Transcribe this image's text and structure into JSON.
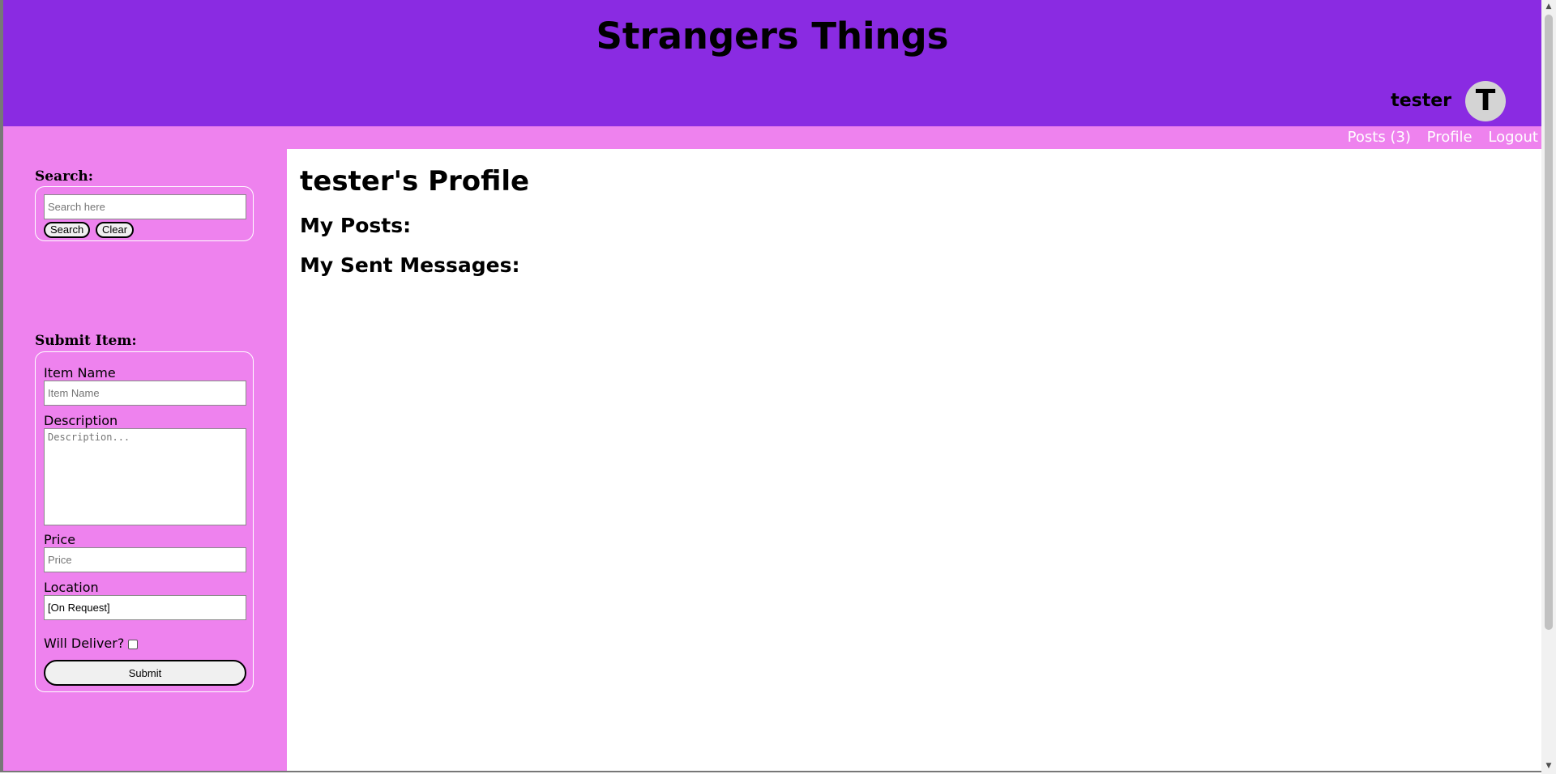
{
  "header": {
    "title": "Strangers Things",
    "username": "tester",
    "avatar_initial": "T",
    "background_color": "#8a2be2"
  },
  "nav": {
    "posts": "Posts (3)",
    "profile": "Profile",
    "logout": "Logout",
    "background_color": "#ee82ee"
  },
  "search": {
    "label": "Search:",
    "placeholder": "Search here",
    "search_button": "Search",
    "clear_button": "Clear"
  },
  "submit_item": {
    "label": "Submit Item:",
    "item_name_label": "Item Name",
    "item_name_placeholder": "Item Name",
    "description_label": "Description",
    "description_placeholder": "Description...",
    "price_label": "Price",
    "price_placeholder": "Price",
    "location_label": "Location",
    "location_value": "[On Request]",
    "will_deliver_label": "Will Deliver?",
    "will_deliver_checked": false,
    "submit_button": "Submit"
  },
  "main": {
    "profile_title": "tester's Profile",
    "my_posts": "My Posts:",
    "my_sent_messages": "My Sent Messages:"
  }
}
